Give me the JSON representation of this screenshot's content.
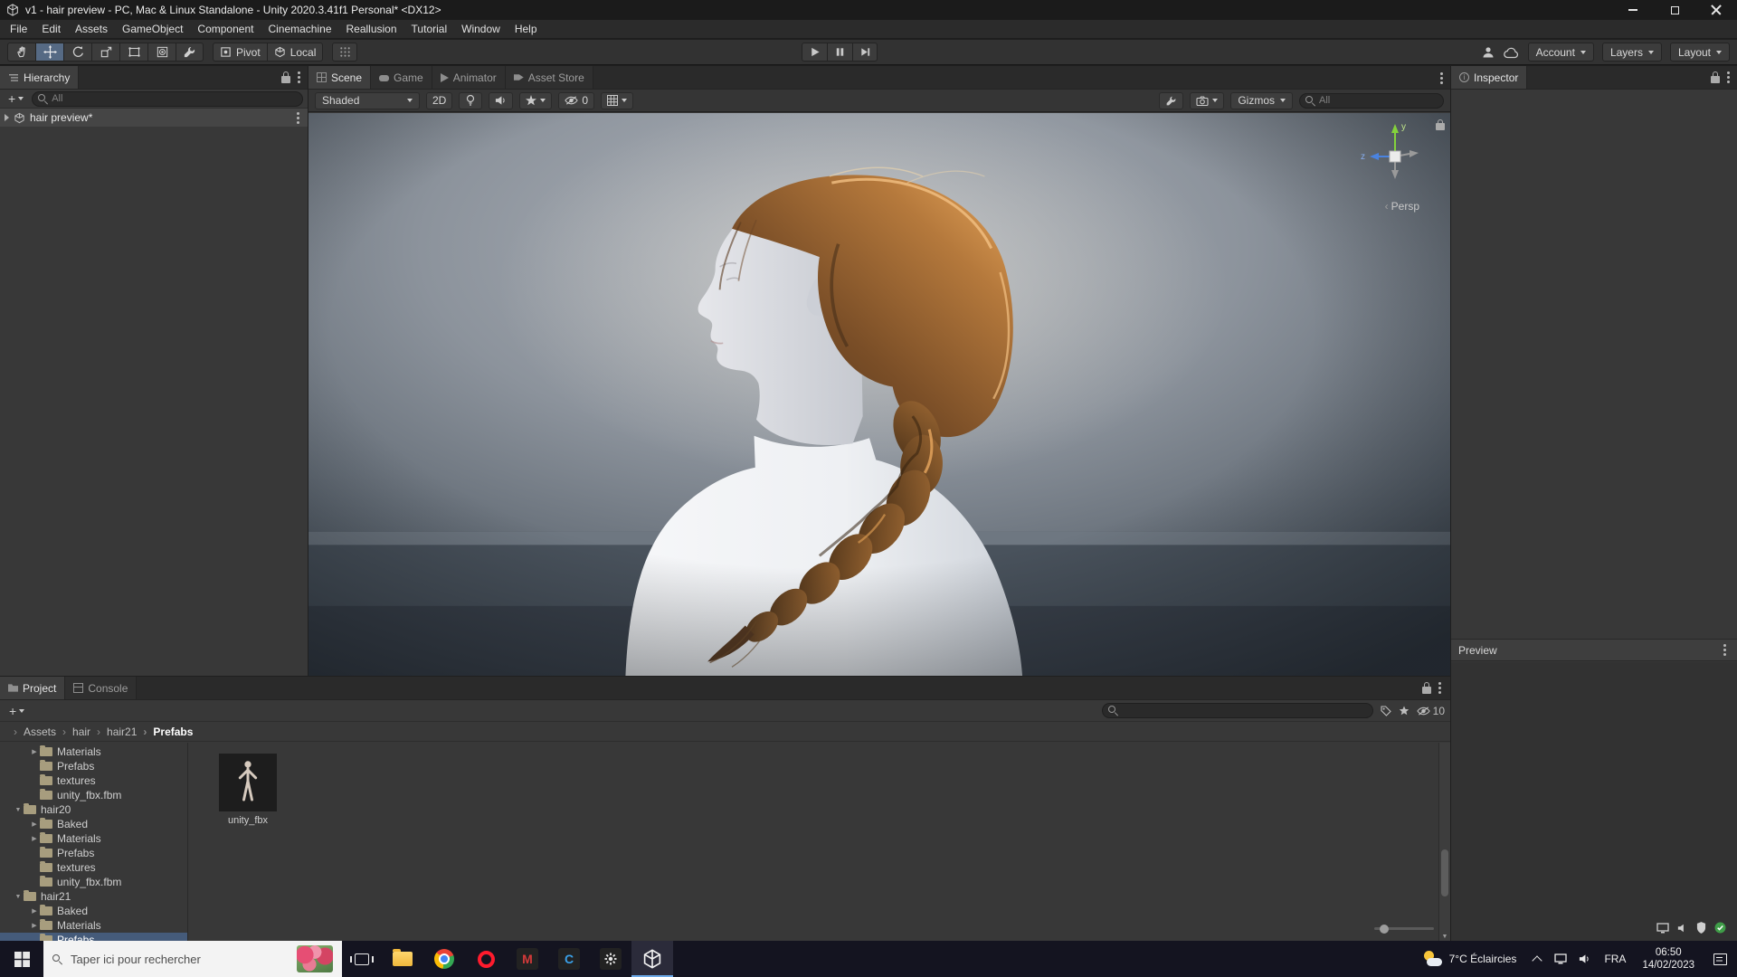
{
  "window": {
    "title": "v1 - hair preview - PC, Mac & Linux Standalone - Unity 2020.3.41f1 Personal* <DX12>"
  },
  "menu": {
    "items": [
      "File",
      "Edit",
      "Assets",
      "GameObject",
      "Component",
      "Cinemachine",
      "Reallusion",
      "Tutorial",
      "Window",
      "Help"
    ]
  },
  "toolbar": {
    "pivot": "Pivot",
    "local": "Local",
    "account": "Account",
    "layers": "Layers",
    "layout": "Layout"
  },
  "hierarchy": {
    "title": "Hierarchy",
    "search_placeholder": "All",
    "scene_row": "hair preview*"
  },
  "scene": {
    "tabs": [
      {
        "label": "Scene",
        "icon": "grid",
        "active": true
      },
      {
        "label": "Game",
        "icon": "gamepad",
        "active": false
      },
      {
        "label": "Animator",
        "icon": "play",
        "active": false
      },
      {
        "label": "Asset Store",
        "icon": "tag",
        "active": false
      }
    ],
    "shading": "Shaded",
    "toggle_2d": "2D",
    "hidden_count": "0",
    "gizmos": "Gizmos",
    "search_placeholder": "All",
    "gizmo": {
      "axis_y": "y",
      "axis_z": "z",
      "projection": "Persp"
    }
  },
  "inspector": {
    "title": "Inspector",
    "preview": "Preview"
  },
  "project": {
    "tabs": [
      {
        "label": "Project",
        "icon": "folder",
        "active": true
      },
      {
        "label": "Console",
        "icon": "console",
        "active": false
      }
    ],
    "breadcrumb": [
      {
        "label": "Assets"
      },
      {
        "label": "hair"
      },
      {
        "label": "hair21"
      },
      {
        "label": "Prefabs",
        "current": true
      }
    ],
    "hidden_count": "10",
    "tree": [
      {
        "label": "Materials",
        "level": 1,
        "arrow": "right"
      },
      {
        "label": "Prefabs",
        "level": 1,
        "arrow": "none"
      },
      {
        "label": "textures",
        "level": 1,
        "arrow": "none"
      },
      {
        "label": "unity_fbx.fbm",
        "level": 1,
        "arrow": "none"
      },
      {
        "label": "hair20",
        "level": 0,
        "arrow": "down"
      },
      {
        "label": "Baked",
        "level": 1,
        "arrow": "right"
      },
      {
        "label": "Materials",
        "level": 1,
        "arrow": "right"
      },
      {
        "label": "Prefabs",
        "level": 1,
        "arrow": "none"
      },
      {
        "label": "textures",
        "level": 1,
        "arrow": "none"
      },
      {
        "label": "unity_fbx.fbm",
        "level": 1,
        "arrow": "none"
      },
      {
        "label": "hair21",
        "level": 0,
        "arrow": "down"
      },
      {
        "label": "Baked",
        "level": 1,
        "arrow": "right"
      },
      {
        "label": "Materials",
        "level": 1,
        "arrow": "right"
      },
      {
        "label": "Prefabs",
        "level": 1,
        "arrow": "none",
        "selected": true
      }
    ],
    "assets": [
      {
        "label": "unity_fbx"
      }
    ]
  },
  "taskbar": {
    "search_placeholder": "Taper ici pour rechercher",
    "weather": "7°C Éclaircies",
    "language": "FRA",
    "time": "06:50",
    "date": "14/02/2023"
  }
}
